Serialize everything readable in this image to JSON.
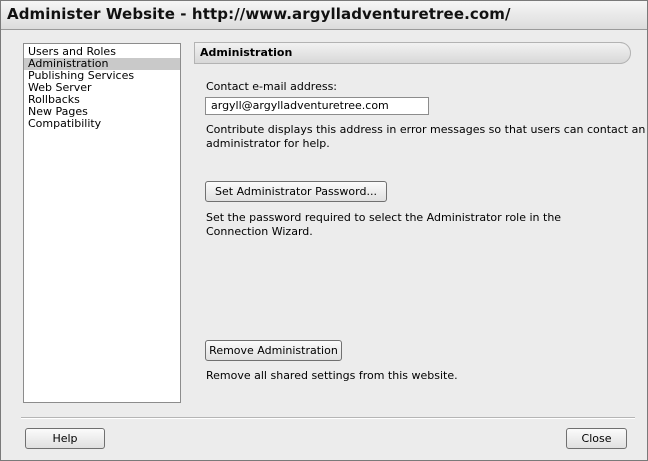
{
  "window": {
    "title": "Administer Website - http://www.argylladventuretree.com/"
  },
  "sidebar": {
    "items": [
      {
        "label": "Users and Roles",
        "selected": false
      },
      {
        "label": "Administration",
        "selected": true
      },
      {
        "label": "Publishing Services",
        "selected": false
      },
      {
        "label": "Web Server",
        "selected": false
      },
      {
        "label": "Rollbacks",
        "selected": false
      },
      {
        "label": "New Pages",
        "selected": false
      },
      {
        "label": "Compatibility",
        "selected": false
      }
    ]
  },
  "main": {
    "section_title": "Administration",
    "contact_label": "Contact e-mail address:",
    "contact_value": "argyll@argylladventuretree.com",
    "contact_help_1": "Contribute displays this address in error messages so that users can contact an",
    "contact_help_2": "administrator for help.",
    "set_password_button": "Set Administrator Password...",
    "password_help_1": "Set the password required to select the Administrator role in the",
    "password_help_2": "Connection Wizard.",
    "remove_button": "Remove Administration",
    "remove_help": "Remove all shared settings from this website."
  },
  "footer": {
    "help_button": "Help",
    "close_button": "Close"
  }
}
